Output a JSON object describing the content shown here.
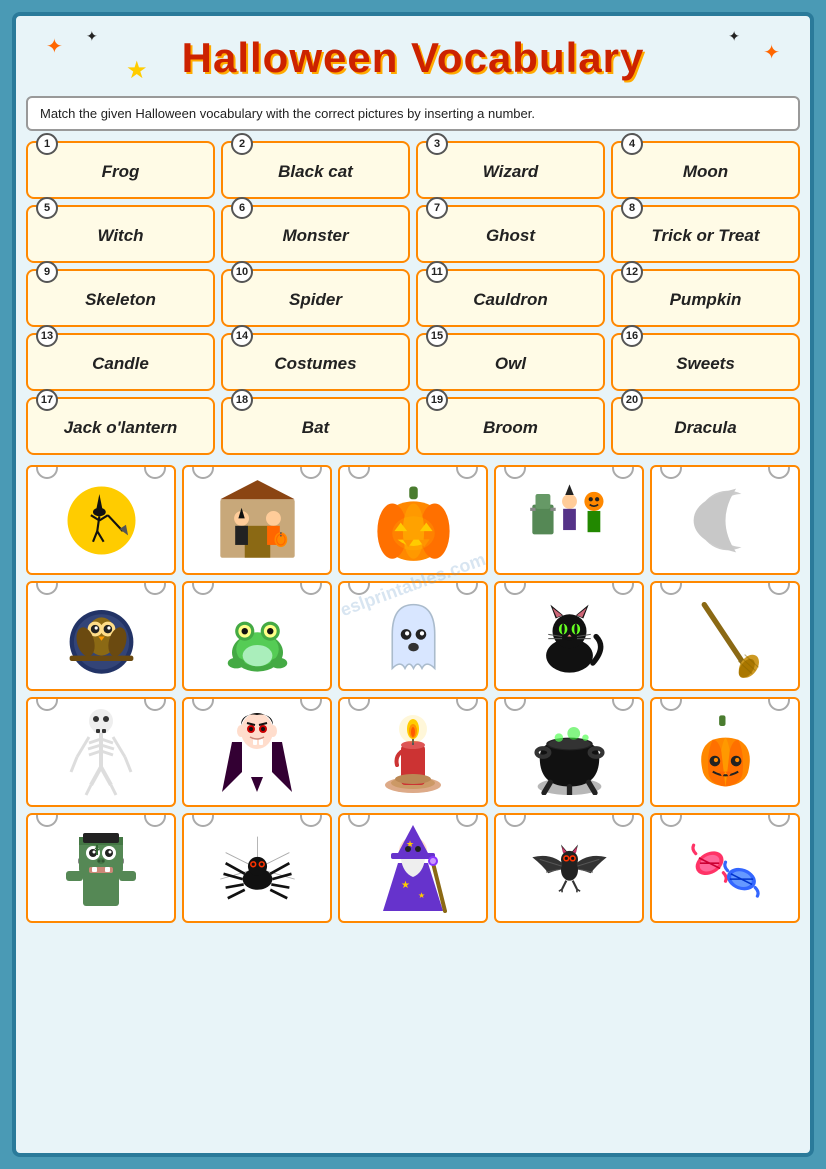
{
  "title": "Halloween Vocabulary",
  "instructions": "Match the given Halloween vocabulary with the correct pictures by inserting a number.",
  "vocab_items": [
    {
      "num": 1,
      "word": "Frog"
    },
    {
      "num": 2,
      "word": "Black cat"
    },
    {
      "num": 3,
      "word": "Wizard"
    },
    {
      "num": 4,
      "word": "Moon"
    },
    {
      "num": 5,
      "word": "Witch"
    },
    {
      "num": 6,
      "word": "Monster"
    },
    {
      "num": 7,
      "word": "Ghost"
    },
    {
      "num": 8,
      "word": "Trick or Treat"
    },
    {
      "num": 9,
      "word": "Skeleton"
    },
    {
      "num": 10,
      "word": "Spider"
    },
    {
      "num": 11,
      "word": "Cauldron"
    },
    {
      "num": 12,
      "word": "Pumpkin"
    },
    {
      "num": 13,
      "word": "Candle"
    },
    {
      "num": 14,
      "word": "Costumes"
    },
    {
      "num": 15,
      "word": "Owl"
    },
    {
      "num": 16,
      "word": "Sweets"
    },
    {
      "num": 17,
      "word": "Jack o'lantern"
    },
    {
      "num": 18,
      "word": "Bat"
    },
    {
      "num": 19,
      "word": "Broom"
    },
    {
      "num": 20,
      "word": "Dracula"
    }
  ],
  "watermark": "eslprintables.com"
}
